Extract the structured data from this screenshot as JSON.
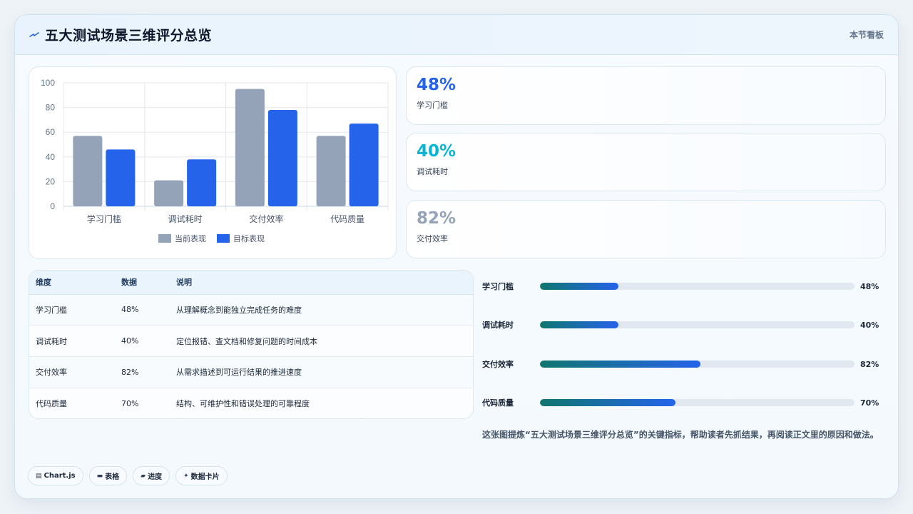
{
  "header": {
    "title": "五大测试场景三维评分总览",
    "meta": "本节看板",
    "icon": "spark-icon"
  },
  "chart_data": {
    "type": "bar",
    "categories": [
      "学习门槛",
      "调试耗时",
      "交付效率",
      "代码质量"
    ],
    "series": [
      {
        "name": "当前表现",
        "values": [
          57,
          21,
          95,
          57
        ],
        "color": "#94a3b8"
      },
      {
        "name": "目标表现",
        "values": [
          46,
          38,
          78,
          67
        ],
        "color": "#2563eb"
      }
    ],
    "ylim": [
      0,
      100
    ],
    "yticks": [
      0,
      20,
      40,
      60,
      80,
      100
    ],
    "grid": true,
    "legend": "bottom"
  },
  "kpis": [
    {
      "value": "48%",
      "label": "学习门槛",
      "color": "#2563eb"
    },
    {
      "value": "40%",
      "label": "调试耗时",
      "color": "#06b6d4"
    },
    {
      "value": "82%",
      "label": "交付效率",
      "color": "#94a3b8"
    }
  ],
  "table": {
    "headers": [
      "维度",
      "数据",
      "说明"
    ],
    "rows": [
      [
        "学习门槛",
        "48%",
        "从理解概念到能独立完成任务的难度"
      ],
      [
        "调试耗时",
        "40%",
        "定位报错、查文档和修复问题的时间成本"
      ],
      [
        "交付效率",
        "82%",
        "从需求描述到可运行结果的推进速度"
      ],
      [
        "代码质量",
        "70%",
        "结构、可维护性和错误处理的可靠程度"
      ]
    ]
  },
  "progress": [
    {
      "label": "学习门槛",
      "value": "48%",
      "fraction": 0.25
    },
    {
      "label": "调试耗时",
      "value": "40%",
      "fraction": 0.25
    },
    {
      "label": "交付效率",
      "value": "82%",
      "fraction": 0.51
    },
    {
      "label": "代码质量",
      "value": "70%",
      "fraction": 0.43
    }
  ],
  "summary": "这张图提炼“五大测试场景三维评分总览”的关键指标，帮助读者先抓结果，再阅读正文里的原因和做法。",
  "chips": [
    {
      "icon": "chart-icon",
      "glyph": "▤",
      "label": "Chart.js"
    },
    {
      "icon": "table-icon",
      "glyph": "▬",
      "label": "表格"
    },
    {
      "icon": "progress-icon",
      "glyph": "▰",
      "label": "进度"
    },
    {
      "icon": "card-icon",
      "glyph": "✦",
      "label": "数据卡片"
    }
  ]
}
